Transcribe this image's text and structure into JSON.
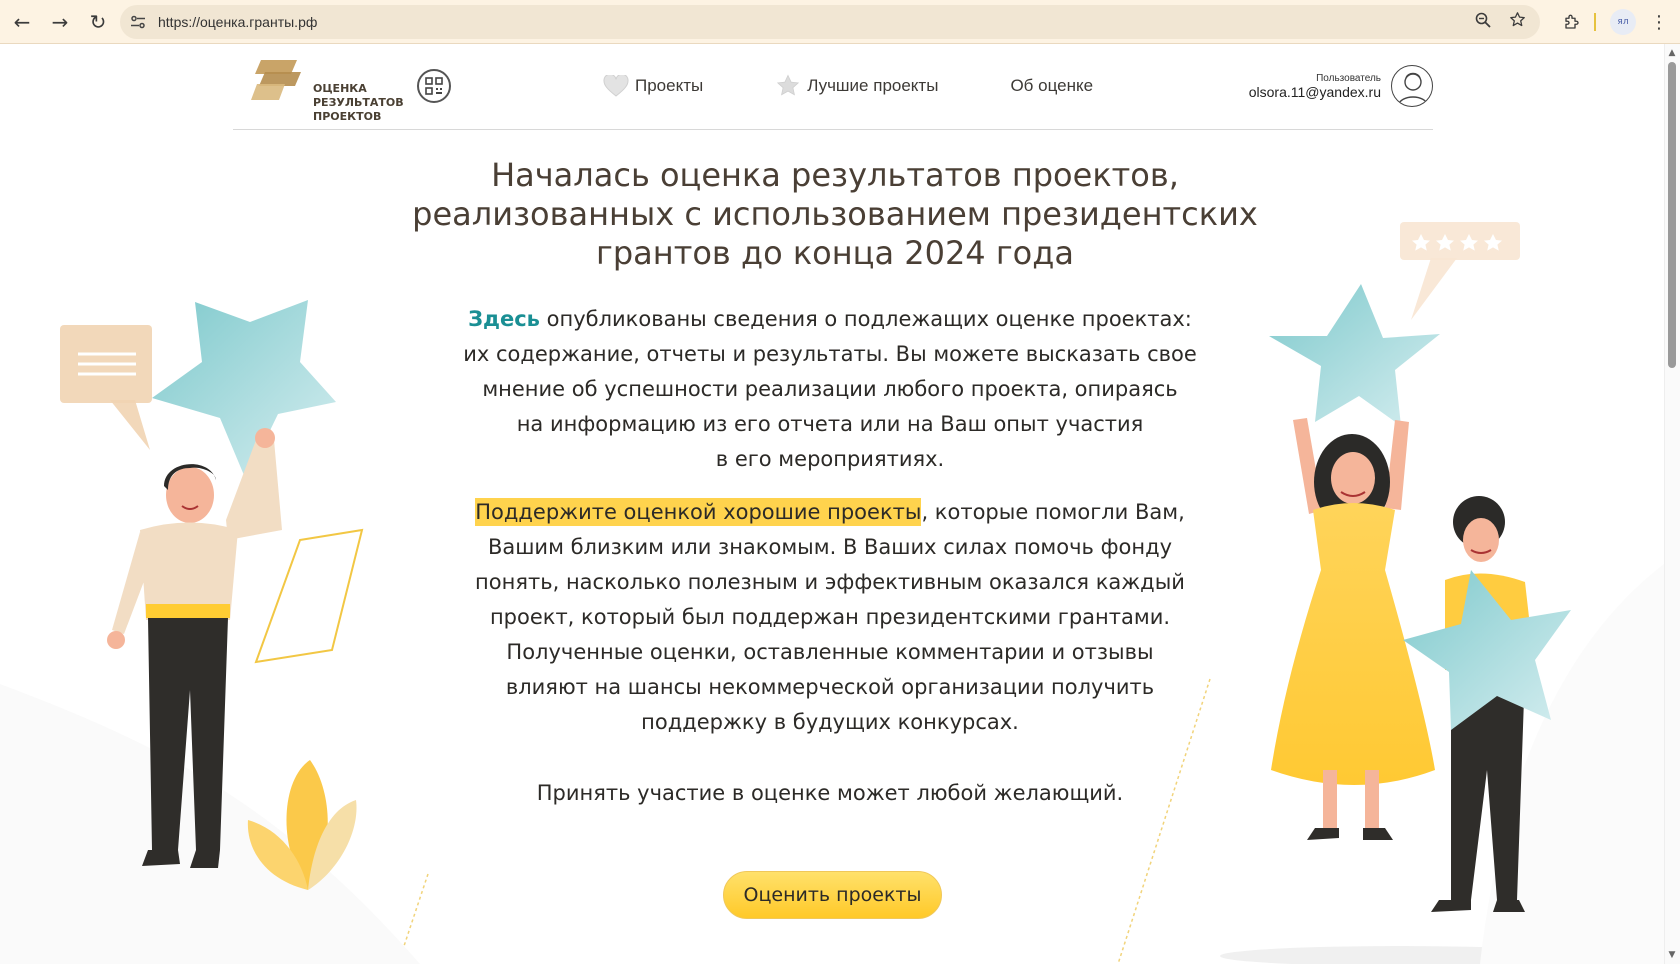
{
  "browser": {
    "url": "https://оценка.гранты.рф",
    "profile_label": "ял"
  },
  "header": {
    "logo_text": [
      "ОЦЕНКА",
      "РЕЗУЛЬТАТОВ",
      "ПРОЕКТОВ"
    ],
    "nav": [
      {
        "label": "Проекты",
        "icon": "heart-icon"
      },
      {
        "label": "Лучшие проекты",
        "icon": "star-icon"
      },
      {
        "label": "Об оценке",
        "icon": null
      }
    ],
    "user_caption": "Пользователь",
    "user_email": "olsora.11@yandex.ru"
  },
  "main": {
    "title_lines": [
      "Началась оценка результатов проектов,",
      "реализованных с использованием президентских",
      "грантов до конца 2024 года"
    ],
    "p1_highlight": "Здесь",
    "p1_line1_rest": " опубликованы сведения о подлежащих оценке проектах:",
    "p1_lines": [
      "их содержание, отчеты и результаты. Вы можете высказать свое",
      "мнение об успешности реализации любого проекта, опираясь",
      "на информацию из его отчета или на Ваш опыт участия",
      "в его мероприятиях."
    ],
    "p2_highlight": "Поддержите оценкой хорошие проекты",
    "p2_line1_rest": ", которые помогли Вам,",
    "p2_lines": [
      "Вашим близким или знакомым. В Ваших силах помочь фонду",
      "понять, насколько полезным и эффективным оказался каждый",
      "проект, который был поддержан президентскими грантами.",
      "Полученные оценки, оставленные комментарии и отзывы",
      "влияют на шансы некоммерческой организации получить",
      "поддержку в будущих конкурсах."
    ],
    "p3": "Принять участие в оценке может любой желающий.",
    "cta_label": "Оценить проекты"
  },
  "colors": {
    "accent_teal": "#1a8f94",
    "highlight_yellow": "#ffd34d",
    "button_yellow": "#ffc928",
    "title_brown": "#4a3f35"
  }
}
